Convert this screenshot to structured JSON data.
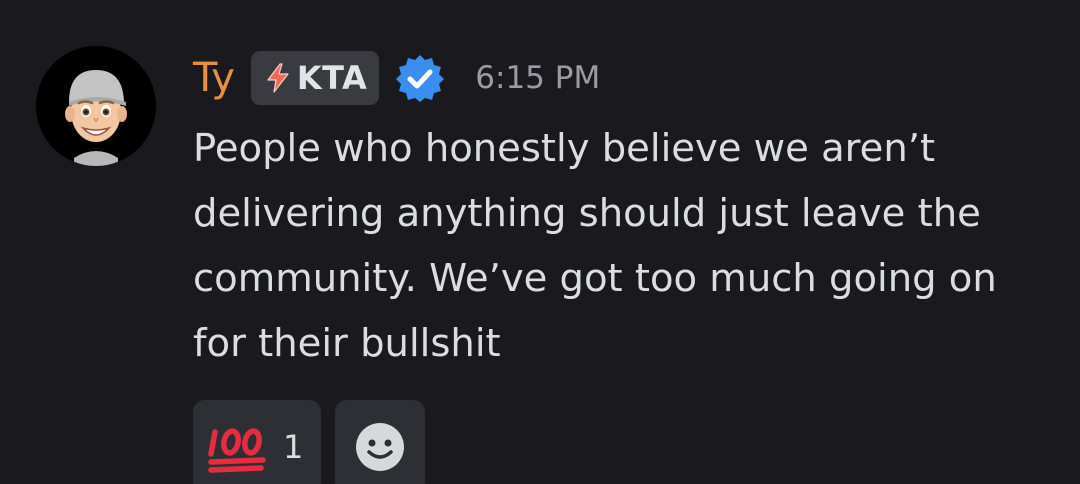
{
  "author": {
    "name": "Ty",
    "name_color": "#e8903f",
    "tag": {
      "icon": "lightning-bolt-icon",
      "label": "KTA"
    },
    "verified": true,
    "verified_icon": "verified-badge-icon",
    "avatar": "memoji-avatar"
  },
  "message": {
    "timestamp": "6:15 PM",
    "text": "People who honestly believe we aren’t delivering anything should just leave the community. We’ve got too much going on for their bullshit"
  },
  "reactions": [
    {
      "emoji": "hundred-points-icon",
      "count": "1"
    }
  ],
  "add_reaction": {
    "icon": "smiley-face-icon"
  },
  "colors": {
    "background": "#1a1a1e",
    "text": "#dcdde1",
    "muted": "#9b9ca3",
    "verified_blue": "#3a8ef0",
    "reaction_bg": "#2e2f35"
  }
}
